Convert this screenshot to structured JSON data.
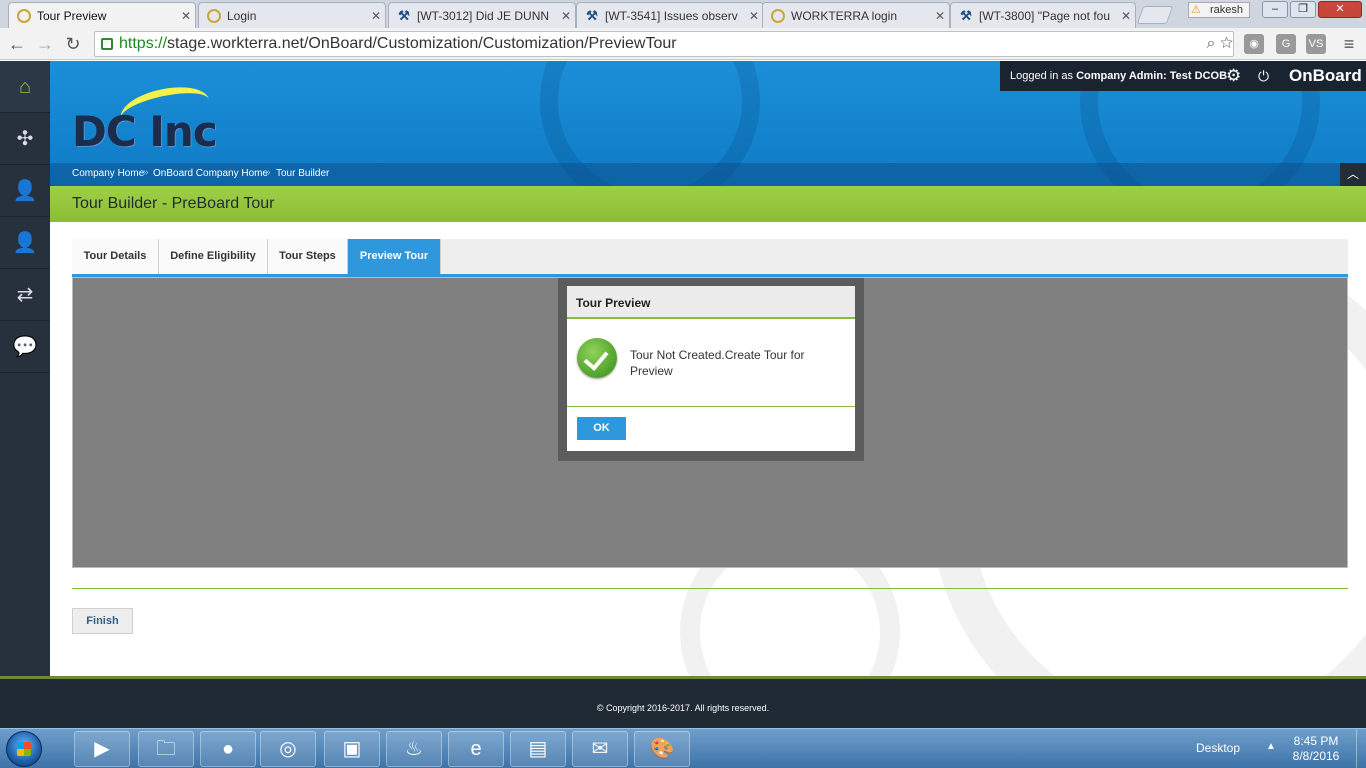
{
  "browser": {
    "tabs": [
      {
        "title": "Tour Preview",
        "active": true,
        "icon": "workterra-icon"
      },
      {
        "title": "Login",
        "active": false,
        "icon": "workterra-icon"
      },
      {
        "title": "[WT-3012] Did JE DUNN",
        "active": false,
        "icon": "jira-icon"
      },
      {
        "title": "[WT-3541] Issues observ",
        "active": false,
        "icon": "jira-icon"
      },
      {
        "title": "WORKTERRA login",
        "active": false,
        "icon": "workterra-icon"
      },
      {
        "title": "[WT-3800] \"Page not fou",
        "active": false,
        "icon": "jira-icon"
      }
    ],
    "user_chip": "rakesh",
    "url_scheme": "https://",
    "url_rest": "stage.workterra.net/OnBoard/Customization/Customization/PreviewTour"
  },
  "sidebar": {
    "items": [
      {
        "name": "home",
        "icon": "home-icon"
      },
      {
        "name": "puzzle",
        "icon": "puzzle-icon"
      },
      {
        "name": "add-user",
        "icon": "user-plus-icon"
      },
      {
        "name": "user",
        "icon": "user-icon"
      },
      {
        "name": "transfer",
        "icon": "arrows-icon"
      },
      {
        "name": "chat",
        "icon": "chat-icon"
      }
    ]
  },
  "header": {
    "logo_text": "DC Inc",
    "logged_in_prefix": "Logged in as",
    "role": "Company Admin:",
    "user_name": "Test DCOB",
    "brand": "OnBoard",
    "breadcrumbs": [
      "Company Home",
      "OnBoard Company Home",
      "Tour Builder"
    ]
  },
  "page": {
    "title": "Tour Builder - PreBoard Tour",
    "tabs": [
      {
        "label": "Tour Details",
        "active": false
      },
      {
        "label": "Define Eligibility",
        "active": false
      },
      {
        "label": "Tour Steps",
        "active": false
      },
      {
        "label": "Preview Tour",
        "active": true
      }
    ],
    "finish_label": "Finish"
  },
  "modal": {
    "title": "Tour Preview",
    "message": "Tour Not Created.Create Tour for Preview",
    "ok_label": "OK",
    "icon": "success-check-icon"
  },
  "footer": {
    "copyright": "© Copyright 2016-2017. All rights reserved."
  },
  "taskbar": {
    "desktop_label": "Desktop",
    "time": "8:45 PM",
    "date": "8/8/2016"
  },
  "colors": {
    "accent_blue": "#2f98dd",
    "accent_green": "#8bbd33",
    "nav_dark": "#26313d"
  }
}
